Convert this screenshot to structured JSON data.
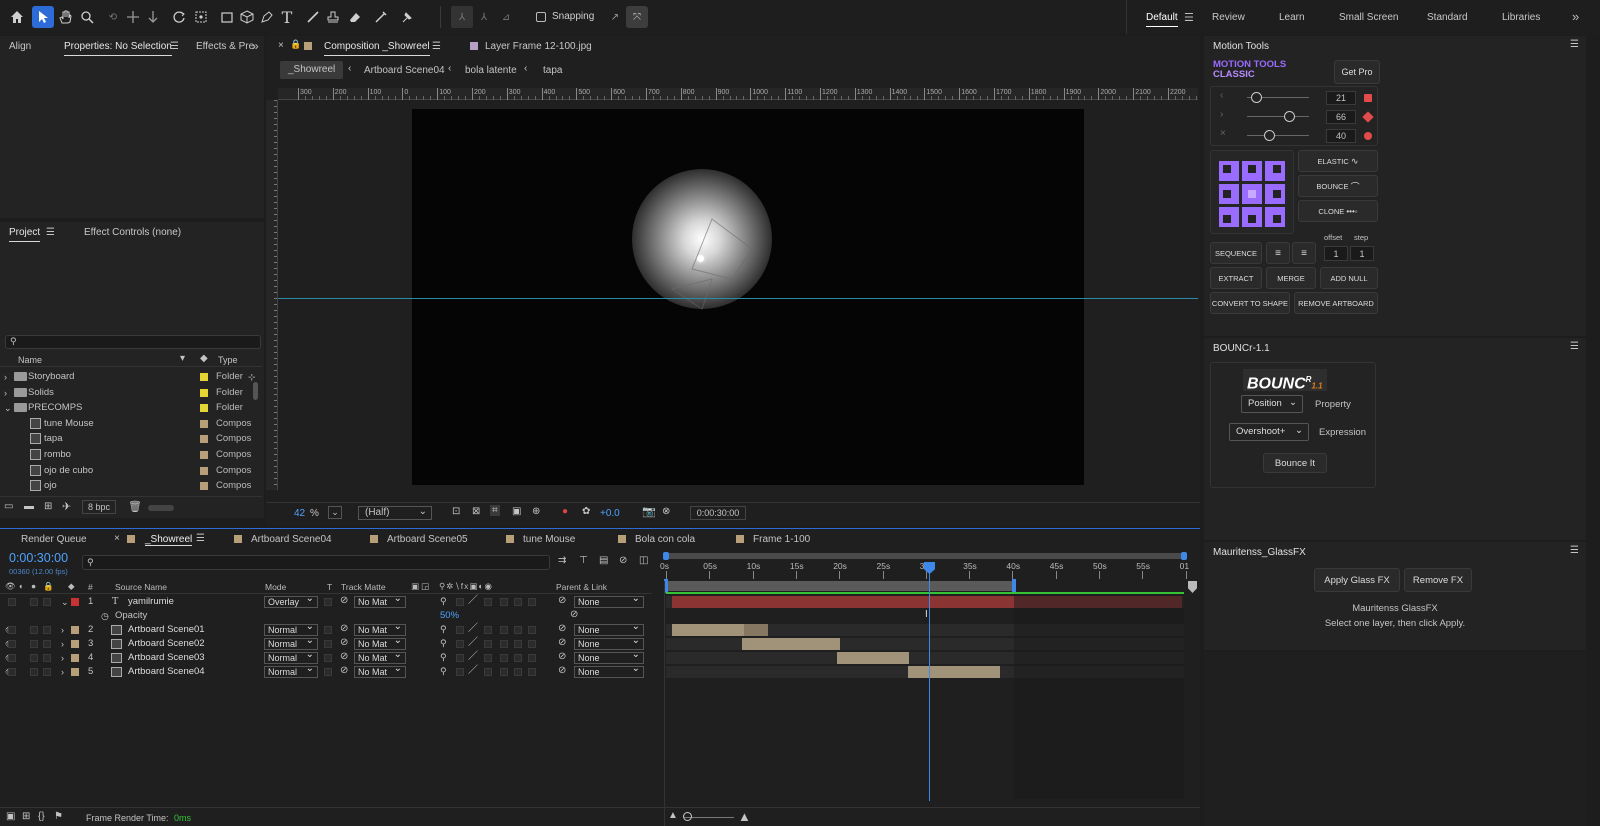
{
  "toolbar": {
    "snapping_label": "Snapping"
  },
  "workspaces": [
    "Default",
    "Review",
    "Learn",
    "Small Screen",
    "Standard",
    "Libraries"
  ],
  "left_top_tabs": {
    "align": "Align",
    "properties": "Properties: No Selection",
    "effects": "Effects & Pre"
  },
  "project": {
    "tab_project": "Project",
    "tab_effect_controls": "Effect Controls (none)",
    "col_name": "Name",
    "col_type": "Type",
    "items": [
      {
        "name": "Storyboard",
        "type": "Folder",
        "color": "#e4d436",
        "kind": "folder"
      },
      {
        "name": "Solids",
        "type": "Folder",
        "color": "#e4d436",
        "kind": "folder"
      },
      {
        "name": "PRECOMPS",
        "type": "Folder",
        "color": "#e4d436",
        "kind": "folder-open"
      },
      {
        "name": "tune Mouse",
        "type": "Compos",
        "color": "#b79f7a",
        "kind": "comp"
      },
      {
        "name": "tapa",
        "type": "Compos",
        "color": "#b79f7a",
        "kind": "comp"
      },
      {
        "name": "rombo",
        "type": "Compos",
        "color": "#b79f7a",
        "kind": "comp"
      },
      {
        "name": "ojo de cubo",
        "type": "Compos",
        "color": "#b79f7a",
        "kind": "comp"
      },
      {
        "name": "ojo",
        "type": "Compos",
        "color": "#b79f7a",
        "kind": "comp"
      }
    ],
    "bpc": "8 bpc"
  },
  "composition": {
    "tab_label": "Composition _Showreel",
    "layer_tab": "Layer Frame 12-100.jpg",
    "breadcrumbs": [
      "_Showreel",
      "Artboard Scene04",
      "bola latente",
      "tapa"
    ],
    "ruler_labels": [
      "300",
      "200",
      "100",
      "0",
      "100",
      "200",
      "300",
      "400",
      "500",
      "600",
      "700",
      "800",
      "900",
      "1000",
      "1100",
      "1200",
      "1300",
      "1400",
      "1500",
      "1600",
      "1700",
      "1800",
      "1900",
      "2000",
      "2100",
      "2200"
    ],
    "zoom": "42",
    "zoom_unit": "%",
    "resolution": "(Half)",
    "exposure": "+0.0",
    "timecode": "0:00:30:00"
  },
  "motion_tools": {
    "panel_title": "Motion Tools",
    "logo_line1": "MOTION TOOLS",
    "logo_line2": "CLASSIC",
    "get_pro": "Get Pro",
    "slider_values": [
      "21",
      "66",
      "40"
    ],
    "buttons": {
      "elastic": "ELASTIC",
      "bounce": "BOUNCE",
      "clone": "CLONE",
      "sequence": "SEQUENCE",
      "extract": "EXTRACT",
      "merge": "MERGE",
      "add_null": "ADD NULL",
      "convert": "CONVERT TO SHAPE",
      "remove_artboard": "REMOVE ARTBOARD"
    },
    "offset_label": "offset",
    "step_label": "step",
    "offset_value": "1",
    "step_value": "1"
  },
  "bouncr": {
    "panel_title": "BOUNCr-1.1",
    "logo": "BOUNC",
    "logo_sup": "R",
    "logo_ver": "1.1",
    "property_value": "Position",
    "property_label": "Property",
    "expression_value": "Overshoot+",
    "expression_label": "Expression",
    "button": "Bounce It"
  },
  "glassfx": {
    "panel_title": "Mauritenss_GlassFX",
    "apply": "Apply Glass FX",
    "remove": "Remove FX",
    "name": "Mauritenss GlassFX",
    "hint": "Select one layer, then click Apply."
  },
  "timeline": {
    "tabs": [
      "Render Queue",
      "_Showreel",
      "Artboard Scene04",
      "Artboard Scene05",
      "tune Mouse",
      "Bola con cola",
      "Frame 1-100"
    ],
    "timecode": "0:00:30:00",
    "fps": "00360 (12.00 fps)",
    "headers": {
      "num": "#",
      "source": "Source Name",
      "mode": "Mode",
      "t": "T",
      "matte": "Track Matte",
      "parent": "Parent & Link"
    },
    "time_labels": [
      "0s",
      "05s",
      "10s",
      "15s",
      "20s",
      "25s",
      "30s",
      "35s",
      "40s",
      "45s",
      "50s",
      "55s",
      "01"
    ],
    "layers": [
      {
        "num": "1",
        "name": "yamilrumie",
        "mode": "Overlay",
        "matte": "No Mat",
        "parent": "None",
        "color": "#c83232"
      },
      {
        "num": "2",
        "name": "Artboard Scene01",
        "mode": "Normal",
        "matte": "No Mat",
        "parent": "None",
        "color": "#b79f7a"
      },
      {
        "num": "3",
        "name": "Artboard Scene02",
        "mode": "Normal",
        "matte": "No Mat",
        "parent": "None",
        "color": "#b79f7a"
      },
      {
        "num": "4",
        "name": "Artboard Scene03",
        "mode": "Normal",
        "matte": "No Mat",
        "parent": "None",
        "color": "#b79f7a"
      },
      {
        "num": "5",
        "name": "Artboard Scene04",
        "mode": "Normal",
        "matte": "No Mat",
        "parent": "None",
        "color": "#b79f7a"
      }
    ],
    "opacity_label": "Opacity",
    "opacity_value": "50%",
    "frame_render_label": "Frame Render Time:",
    "frame_render_value": "0ms"
  }
}
